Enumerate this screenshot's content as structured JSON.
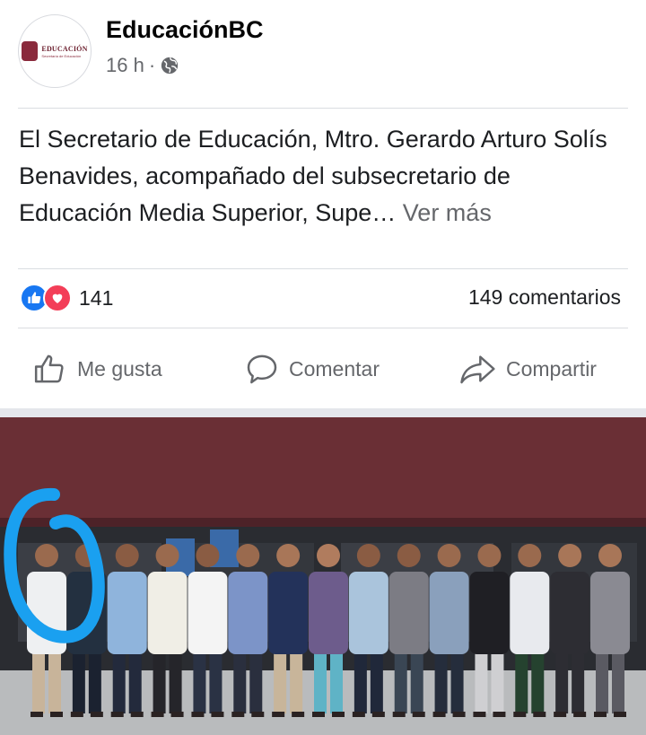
{
  "post": {
    "page_name": "EducaciónBC",
    "time": "16 h",
    "separator": "·",
    "avatar_logo": {
      "title": "EDUCACIÓN",
      "subtitle": "Secretaría de Educación"
    },
    "text": "El Secretario de Educación, Mtro. Gerardo Arturo Solís Benavides, acompañado del subsecretario de Educación Media Superior, Supe…",
    "see_more": "Ver más",
    "reactions_count": "141",
    "comments_count": "149 comentarios",
    "actions": {
      "like": "Me gusta",
      "comment": "Comentar",
      "share": "Compartir"
    }
  },
  "colors": {
    "like_blue": "#1877f2",
    "love_red": "#f33e58",
    "secondary_text": "#65676b",
    "highlight_circle": "#1aa0f0",
    "building_wall": "#6a2f35"
  },
  "icons": [
    "globe-icon",
    "like-reaction-icon",
    "love-reaction-icon",
    "thumbs-up-icon",
    "comment-icon",
    "share-icon"
  ],
  "photo": {
    "people": [
      {
        "shirt": "#eef0f2",
        "pants": "#c8b49a",
        "skin": "#9a6a4e"
      },
      {
        "shirt": "#233040",
        "pants": "#1b2230",
        "skin": "#8a5c43"
      },
      {
        "shirt": "#8fb4dc",
        "pants": "#232a3c",
        "skin": "#8a5c43"
      },
      {
        "shirt": "#f0eee6",
        "pants": "#25252a",
        "skin": "#9a6a4e"
      },
      {
        "shirt": "#f4f4f4",
        "pants": "#2a3244",
        "skin": "#8a5c43"
      },
      {
        "shirt": "#7c94c8",
        "pants": "#2a2f3e",
        "skin": "#9a6a4e"
      },
      {
        "shirt": "#23325a",
        "pants": "#c8b59a",
        "skin": "#a87658"
      },
      {
        "shirt": "#6d5c8c",
        "pants": "#5fb3c6",
        "skin": "#b07c5e"
      },
      {
        "shirt": "#aac4dc",
        "pants": "#20283a",
        "skin": "#8a5c43"
      },
      {
        "shirt": "#7c7c84",
        "pants": "#3a4654",
        "skin": "#8a5c43"
      },
      {
        "shirt": "#8aa0bc",
        "pants": "#252d3c",
        "skin": "#9a6a4e"
      },
      {
        "shirt": "#1f1f24",
        "pants": "#cfcfd2",
        "skin": "#9a6a4e"
      },
      {
        "shirt": "#e8eaee",
        "pants": "#25422f",
        "skin": "#9a6a4e"
      },
      {
        "shirt": "#2d2d33",
        "pants": "#2d2d33",
        "skin": "#a87658"
      },
      {
        "shirt": "#8a8a92",
        "pants": "#5a5a62",
        "skin": "#a87658"
      }
    ]
  }
}
